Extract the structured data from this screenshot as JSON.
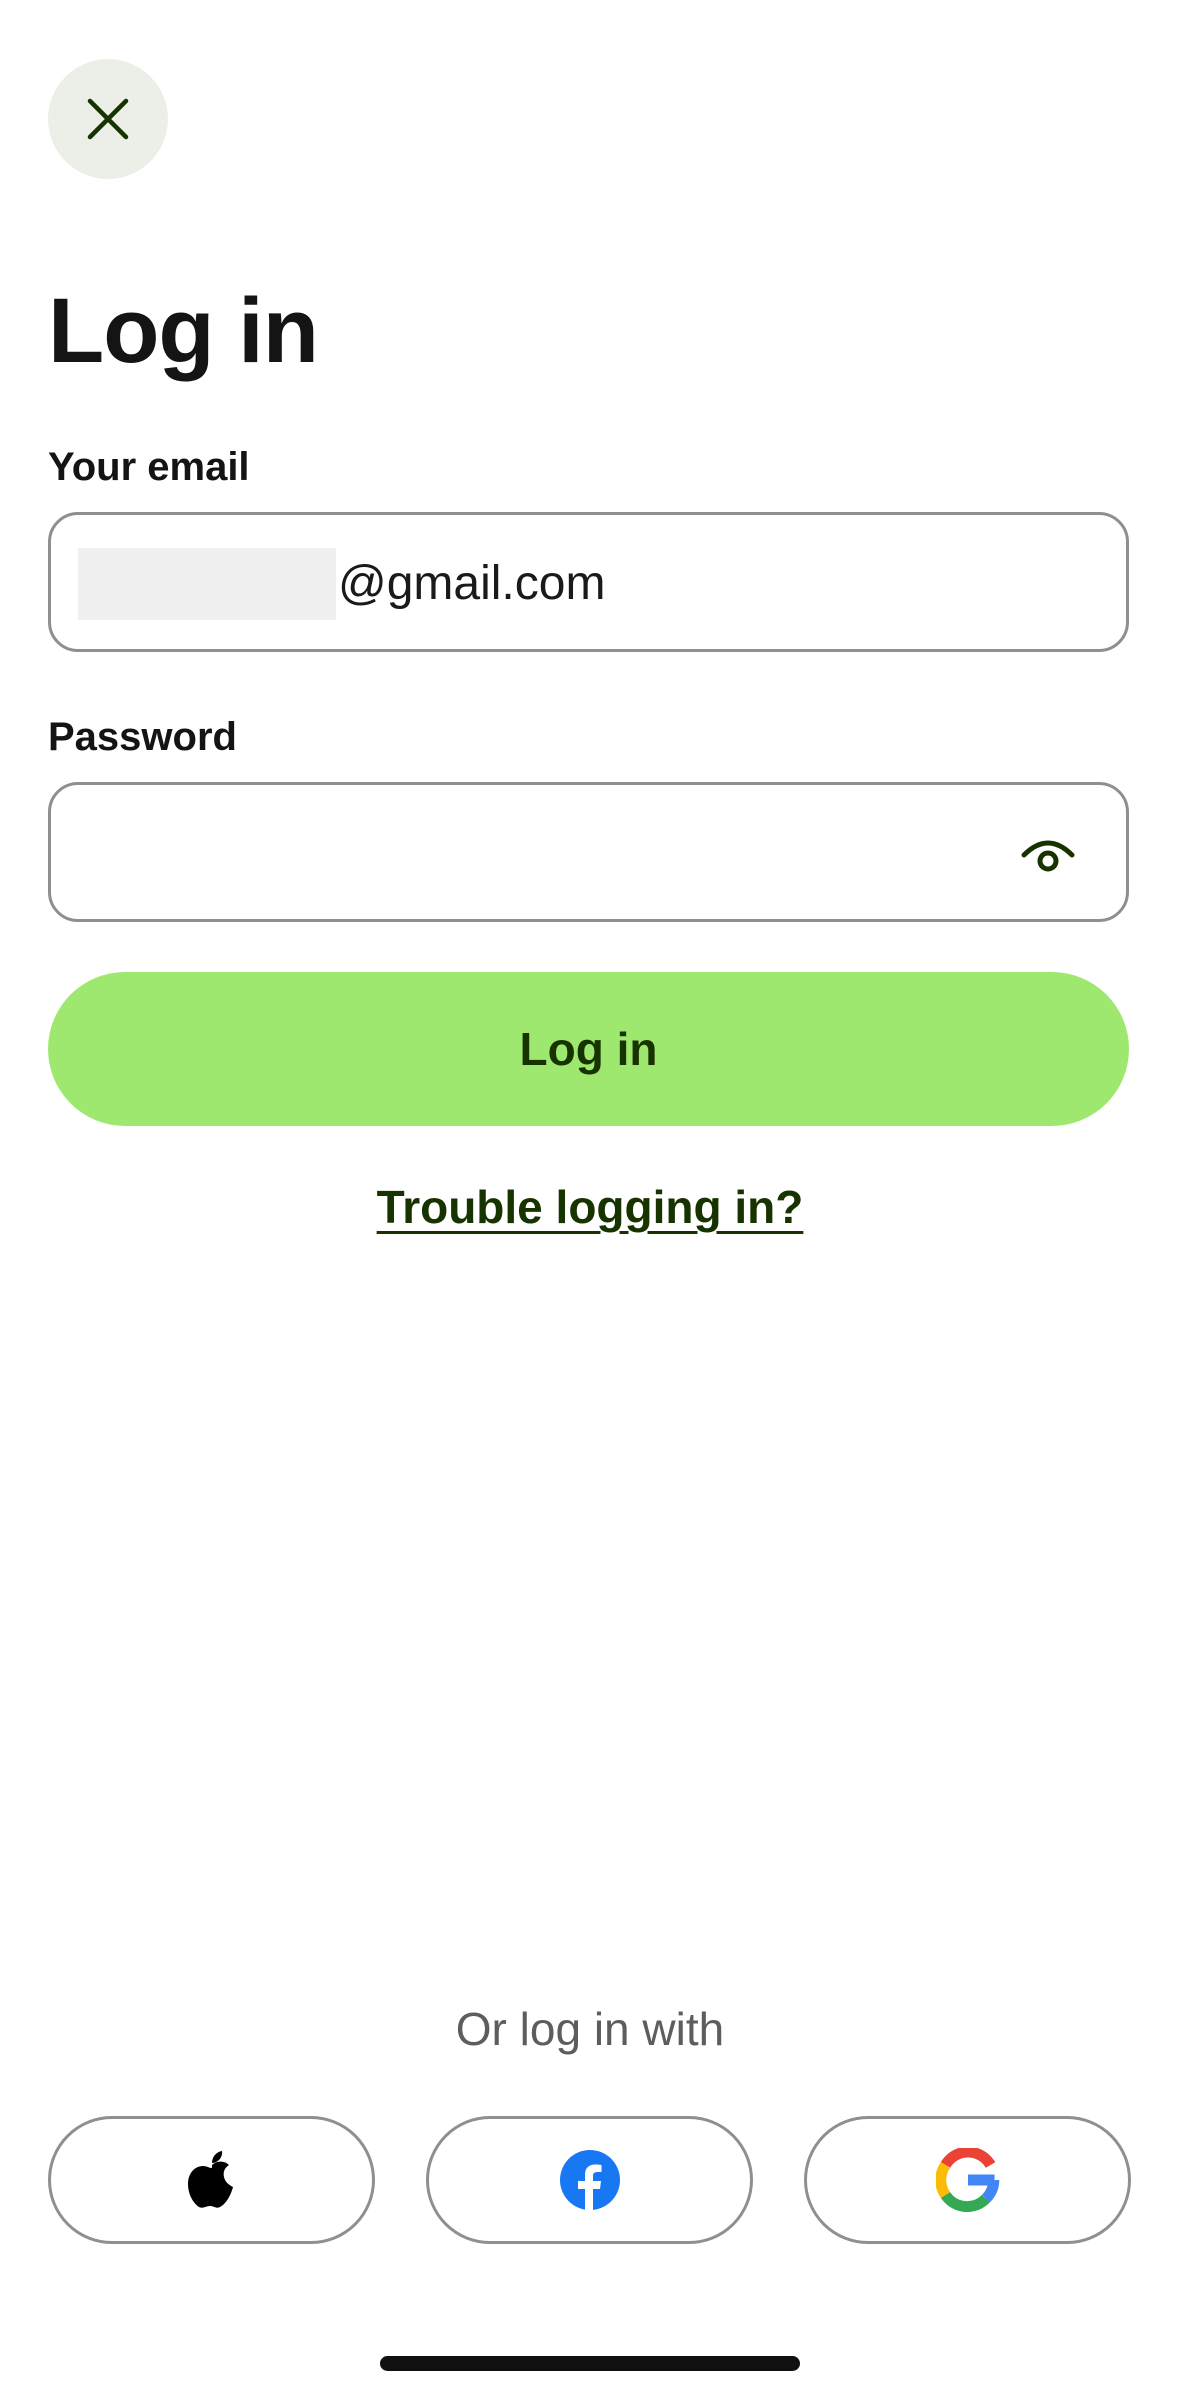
{
  "header": {
    "close_icon": "close-icon"
  },
  "page": {
    "title": "Log in"
  },
  "email": {
    "label": "Your email",
    "value_visible": "@gmail.com"
  },
  "password": {
    "label": "Password",
    "value": "",
    "toggle_icon": "eye-icon"
  },
  "actions": {
    "login_label": "Log in",
    "trouble_label": "Trouble logging in?"
  },
  "social": {
    "divider_text": "Or log in with",
    "providers": [
      {
        "name": "Apple",
        "icon": "apple-icon"
      },
      {
        "name": "Facebook",
        "icon": "facebook-icon"
      },
      {
        "name": "Google",
        "icon": "google-icon"
      }
    ]
  },
  "colors": {
    "primary": "#9fe870",
    "primary_text": "#163300",
    "close_bg": "#eceee8",
    "border": "#8f8f8f",
    "facebook": "#1877f2"
  }
}
